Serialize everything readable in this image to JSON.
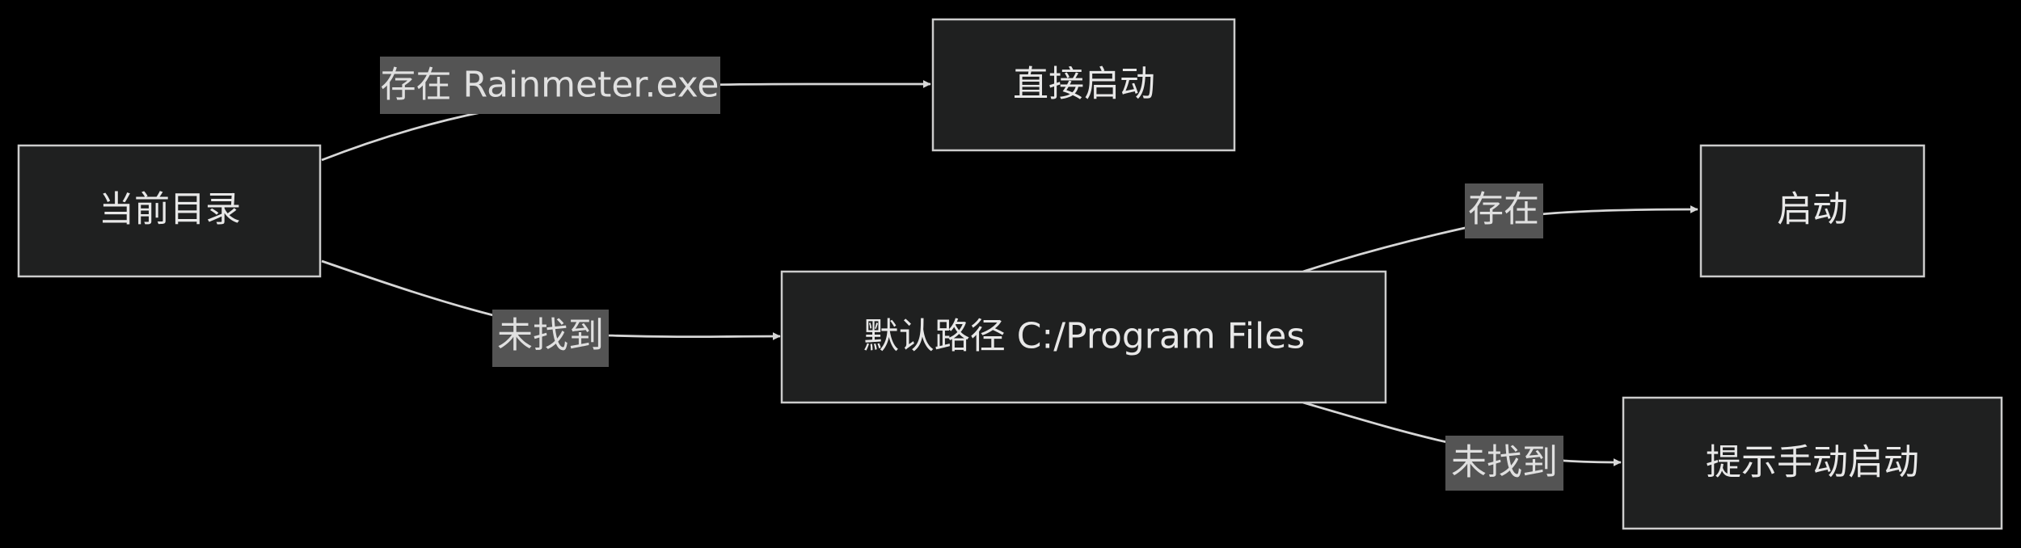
{
  "nodes": {
    "current_dir": "当前目录",
    "direct_start": "直接启动",
    "default_path": "默认路径 C:/Program Files",
    "start": "启动",
    "manual_start": "提示手动启动"
  },
  "edges": {
    "exists_exe": "存在 Rainmeter.exe",
    "not_found_1": "未找到",
    "exists": "存在",
    "not_found_2": "未找到"
  }
}
